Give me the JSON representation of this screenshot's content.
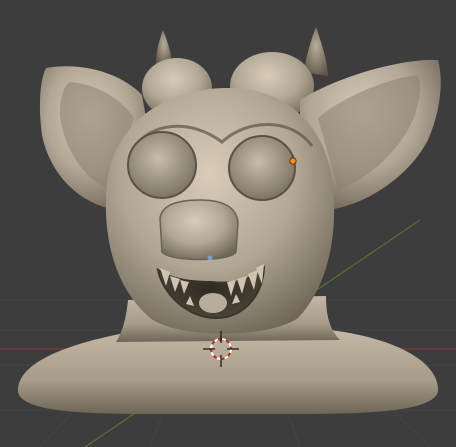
{
  "viewport": {
    "background": "#3d3d3d",
    "grid_color": "#454545",
    "x_axis_color": "#8a3a3a",
    "y_axis_color": "#5e7a2e"
  },
  "model": {
    "clay_color": "#b2a795",
    "shadow_color": "#4f483d",
    "highlight_color": "#d8ccb8"
  },
  "gizmos": {
    "selected_point_color": "#ff8a00",
    "object_origin_color": "#6fa3d9",
    "cursor_ring_color": "#cc2222",
    "cursor_icon": "3d-cursor-icon"
  }
}
